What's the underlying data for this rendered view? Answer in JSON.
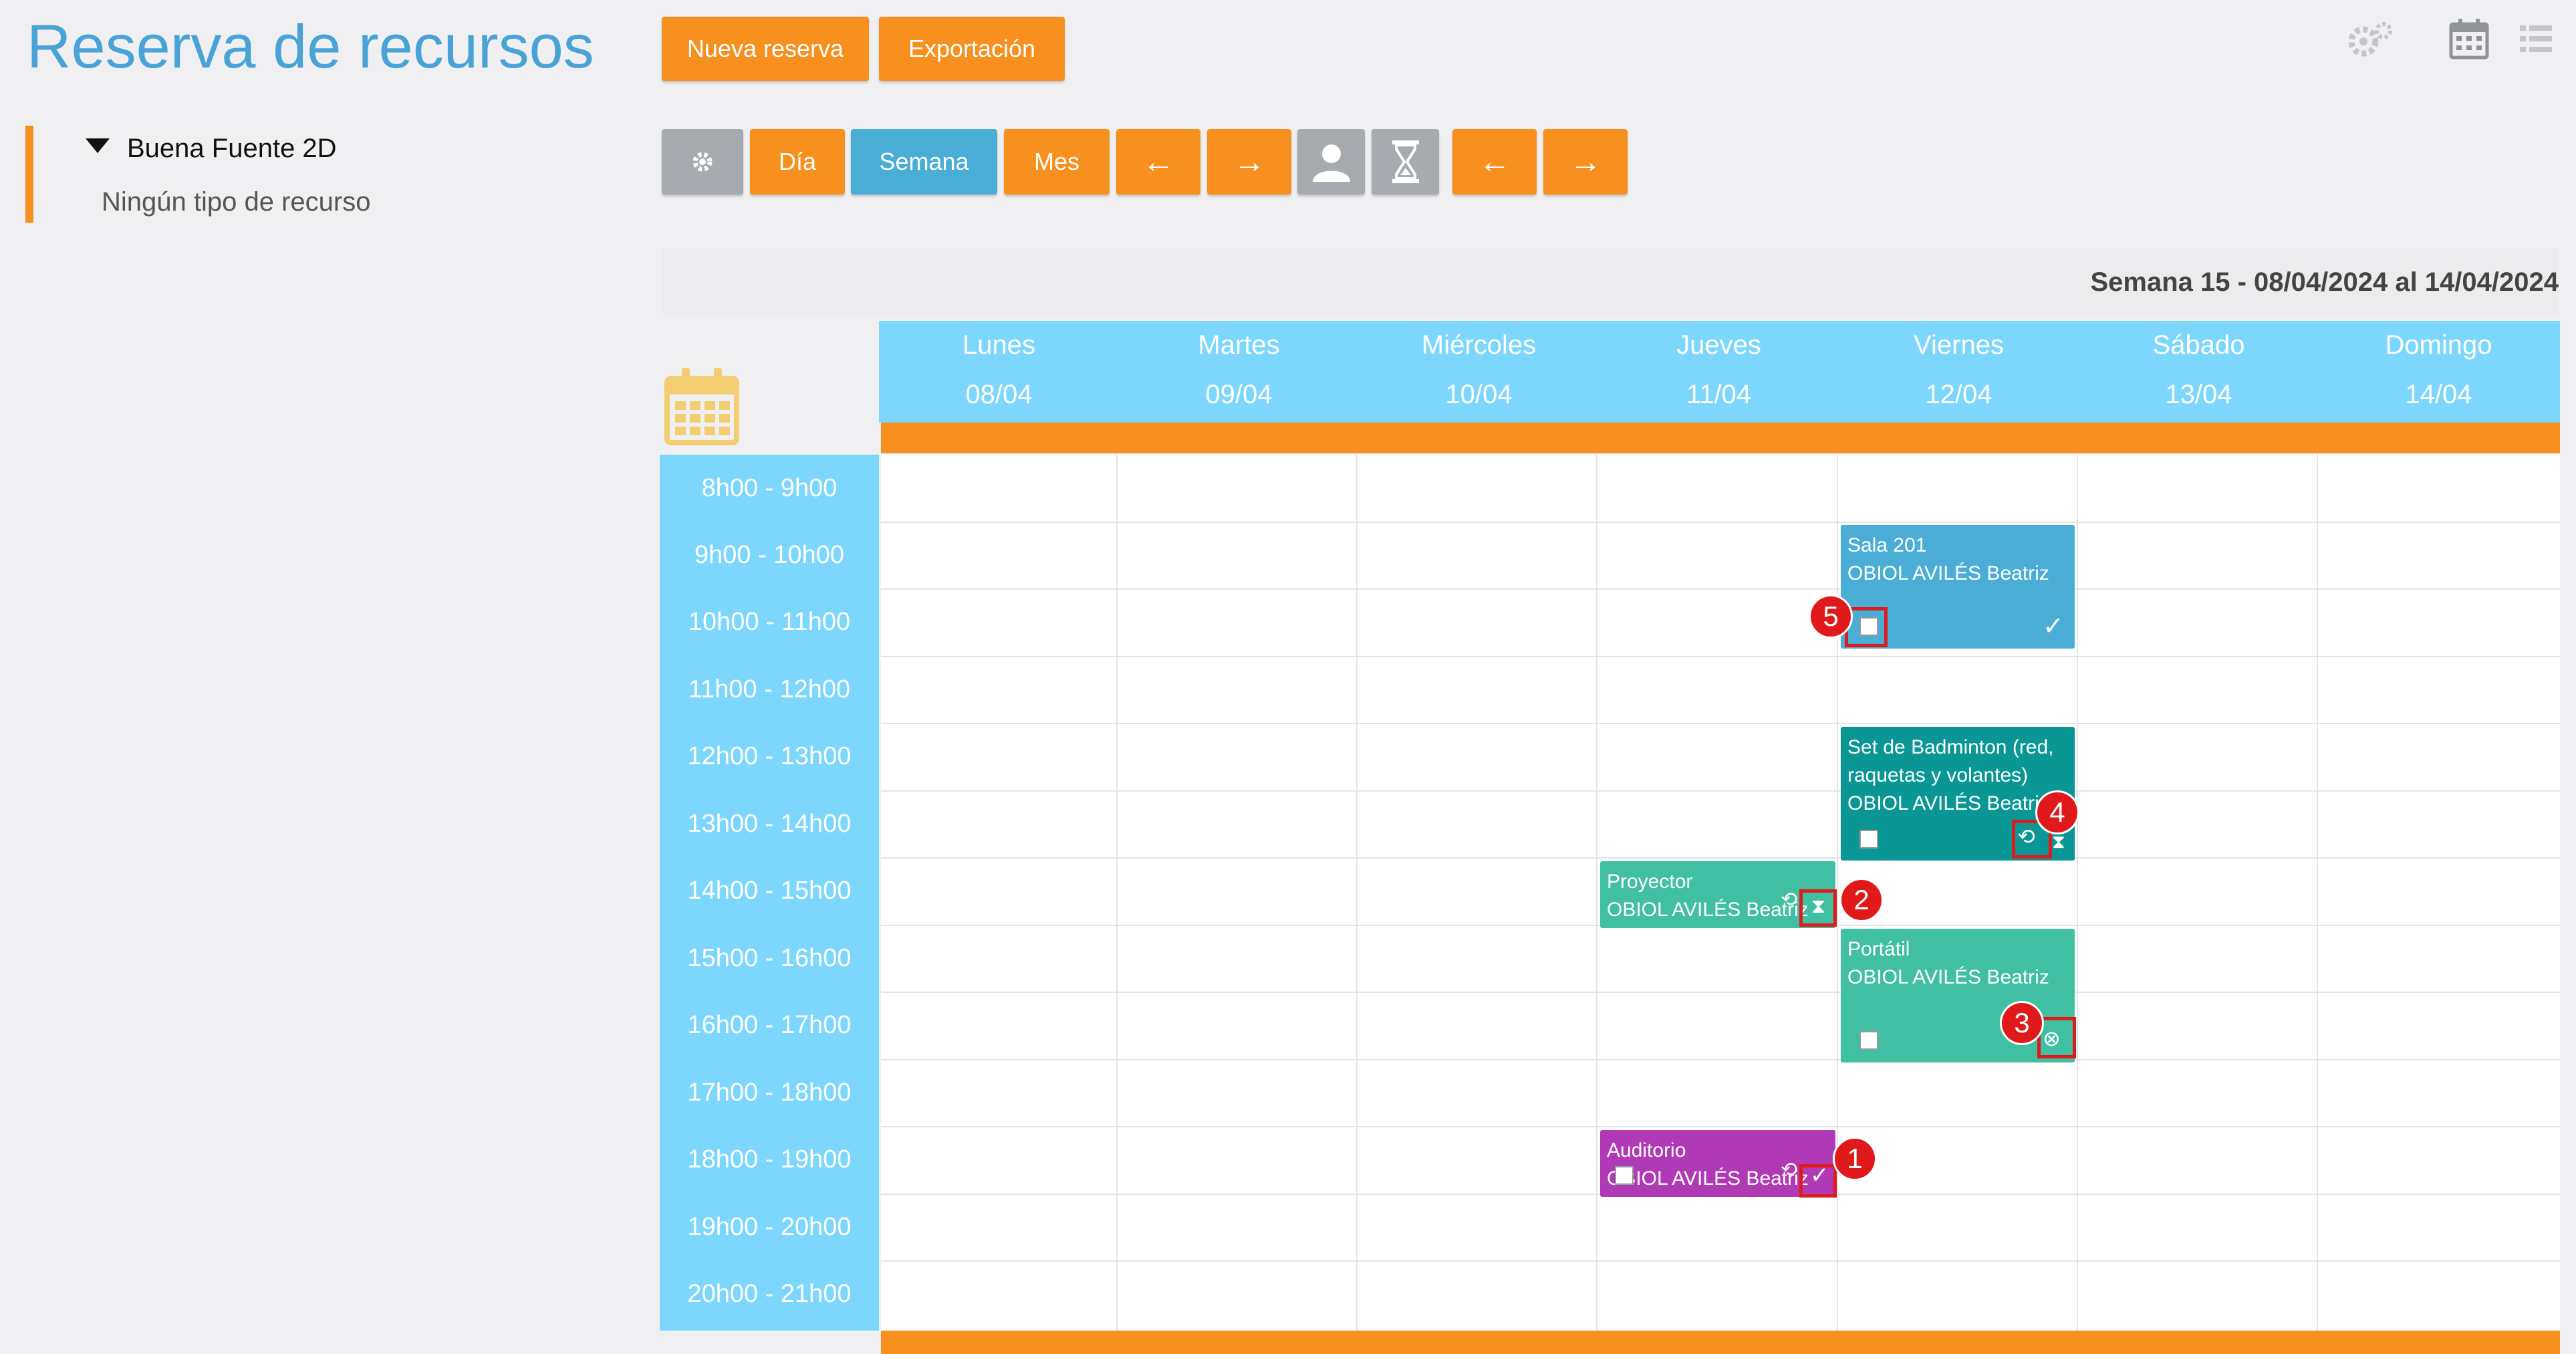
{
  "app": {
    "title": "Reserva de recursos"
  },
  "sidebar": {
    "group_label": "Buena Fuente 2D",
    "empty_label": "Ningún tipo de recurso"
  },
  "toolbar": {
    "new_booking": "Nueva reserva",
    "export": "Exportación",
    "views": {
      "day": "Día",
      "week": "Semana",
      "month": "Mes"
    },
    "prev_arrow": "←",
    "next_arrow": "→",
    "active_view": "week"
  },
  "week": {
    "label": "Semana 15 - 08/04/2024 al 14/04/2024"
  },
  "days": [
    {
      "name": "Lunes",
      "date": "08/04"
    },
    {
      "name": "Martes",
      "date": "09/04"
    },
    {
      "name": "Miércoles",
      "date": "10/04"
    },
    {
      "name": "Jueves",
      "date": "11/04"
    },
    {
      "name": "Viernes",
      "date": "12/04"
    },
    {
      "name": "Sábado",
      "date": "13/04"
    },
    {
      "name": "Domingo",
      "date": "14/04"
    }
  ],
  "time_slots": [
    "8h00 - 9h00",
    "9h00 - 10h00",
    "10h00 - 11h00",
    "11h00 - 12h00",
    "12h00 - 13h00",
    "13h00 - 14h00",
    "14h00 - 15h00",
    "15h00 - 16h00",
    "16h00 - 17h00",
    "17h00 - 18h00",
    "18h00 - 19h00",
    "19h00 - 20h00",
    "20h00 - 21h00"
  ],
  "events": [
    {
      "resource": "Sala 201",
      "user": "OBIOL AVILÉS Beatriz",
      "day": "Viernes",
      "start": "9h00",
      "end": "11h00",
      "color": "#4aadd6"
    },
    {
      "resource_line1": "Set de Badminton (red,",
      "resource_line2": "raquetas y volantes)",
      "user": "OBIOL AVILÉS Beatriz",
      "day": "Viernes",
      "start": "12h00",
      "end": "14h00",
      "color": "#0a9694"
    },
    {
      "resource": "Proyector",
      "user": "OBIOL AVILÉS Beatriz",
      "day": "Jueves",
      "start": "14h00",
      "end": "15h00",
      "color": "#41bfa3"
    },
    {
      "resource": "Portátil",
      "user": "OBIOL AVILÉS Beatriz",
      "day": "Viernes",
      "start": "15h00",
      "end": "17h00",
      "color": "#41bfa3"
    },
    {
      "resource": "Auditorio",
      "user": "OBIOL AVILÉS Beatriz",
      "day": "Jueves",
      "start": "18h00",
      "end": "19h00",
      "color": "#b03ab5"
    }
  ],
  "markers": [
    "1",
    "2",
    "3",
    "4",
    "5"
  ],
  "colors": {
    "accent_orange": "#f7901e",
    "accent_blue": "#4aadd6",
    "header_blue": "#7dd7fc",
    "marker_red": "#e01a1a"
  },
  "icons": [
    "settings-icon",
    "user-icon",
    "hourglass-icon",
    "calendar-icon",
    "list-icon",
    "gears-icon",
    "check-icon",
    "revert-icon",
    "cancel-icon"
  ]
}
